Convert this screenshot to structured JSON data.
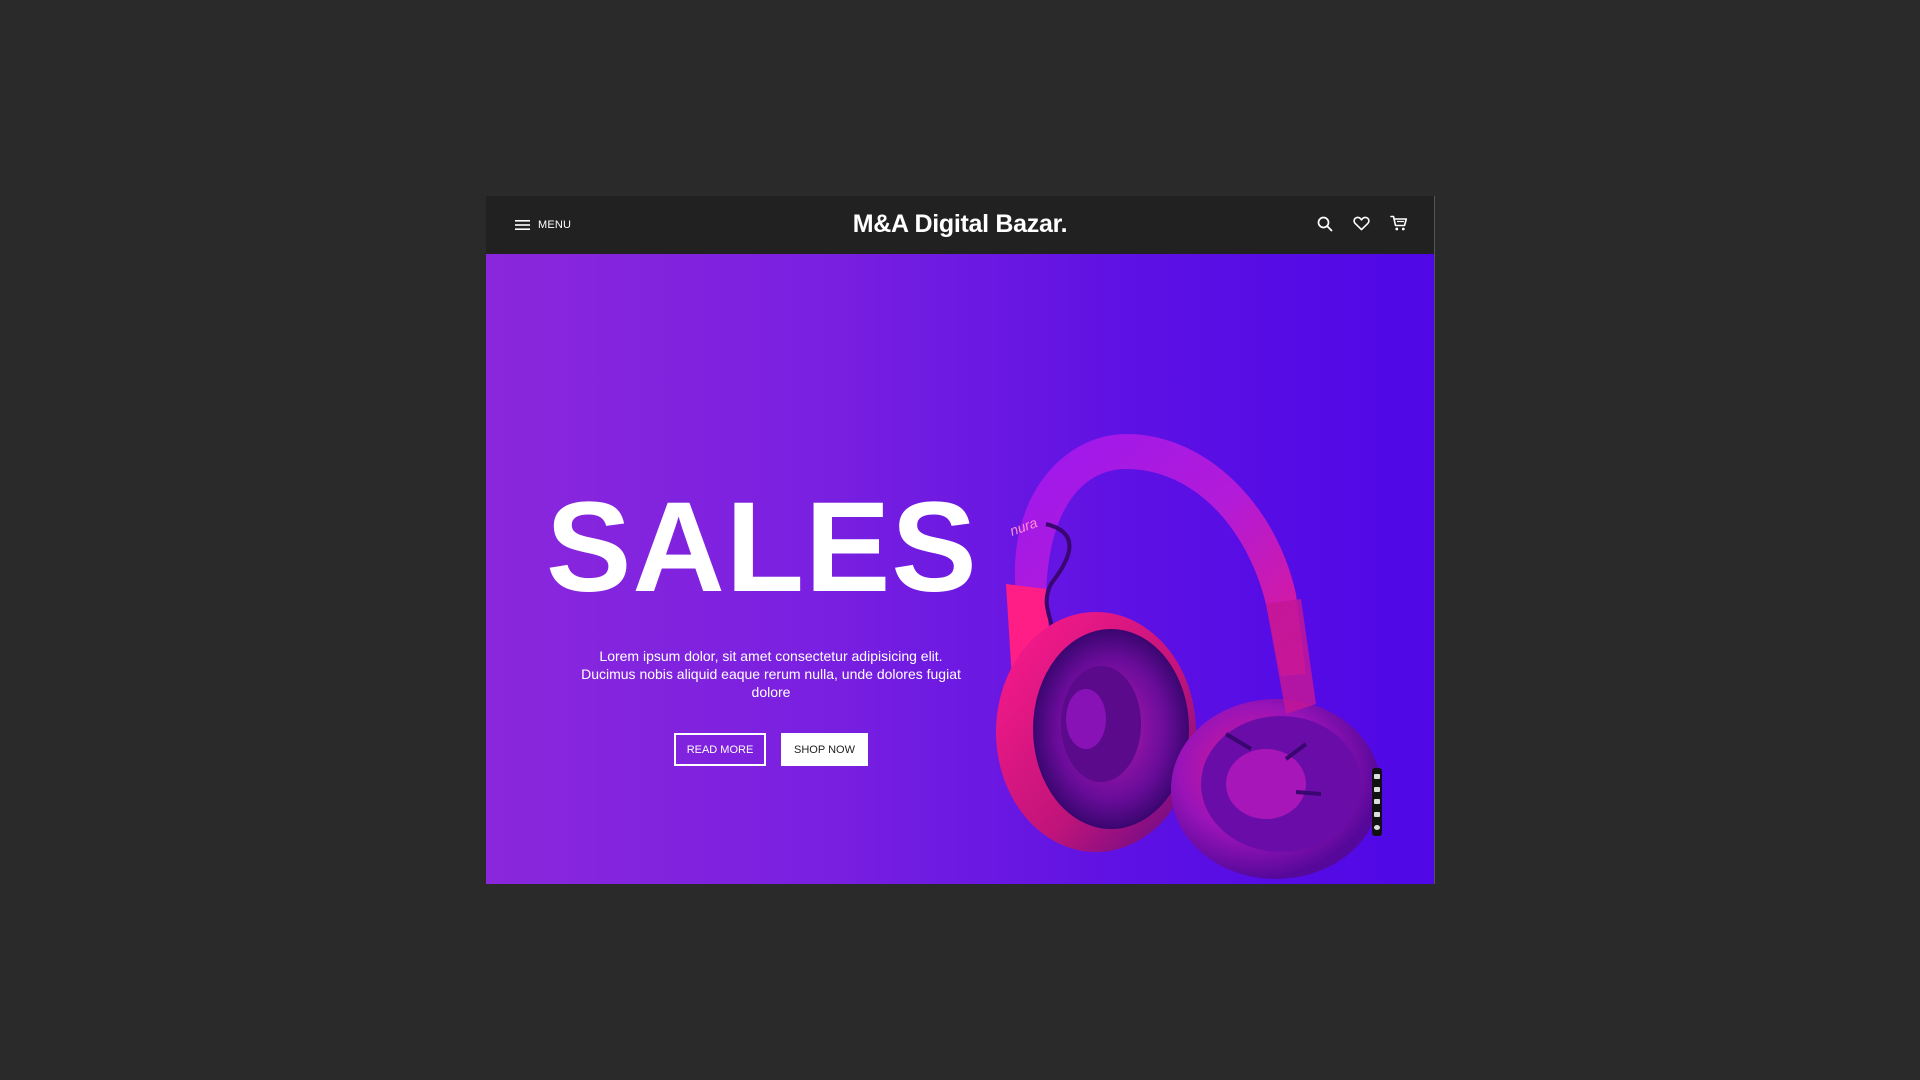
{
  "navbar": {
    "menu_label": "MENU",
    "brand": "M&A Digital Bazar.",
    "icons": [
      "search-icon",
      "heart-icon",
      "cart-icon"
    ]
  },
  "hero": {
    "title": "SALES",
    "description": "Lorem ipsum dolor, sit amet consectetur adipisicing elit. Ducimus nobis aliquid eaque rerum nulla, unde dolores fugiat dolore",
    "read_more_label": "READ MORE",
    "shop_now_label": "SHOP NOW",
    "product_brand": "nura",
    "colors": {
      "gradient_start": "#8a27dc",
      "gradient_end": "#4f07e6",
      "accent_pink": "#ff1a8c"
    }
  },
  "side_toolbar": {
    "icons": [
      "pen-icon",
      "camera-icon",
      "rectangle-icon",
      "monitor-icon",
      "settings-icon"
    ]
  }
}
